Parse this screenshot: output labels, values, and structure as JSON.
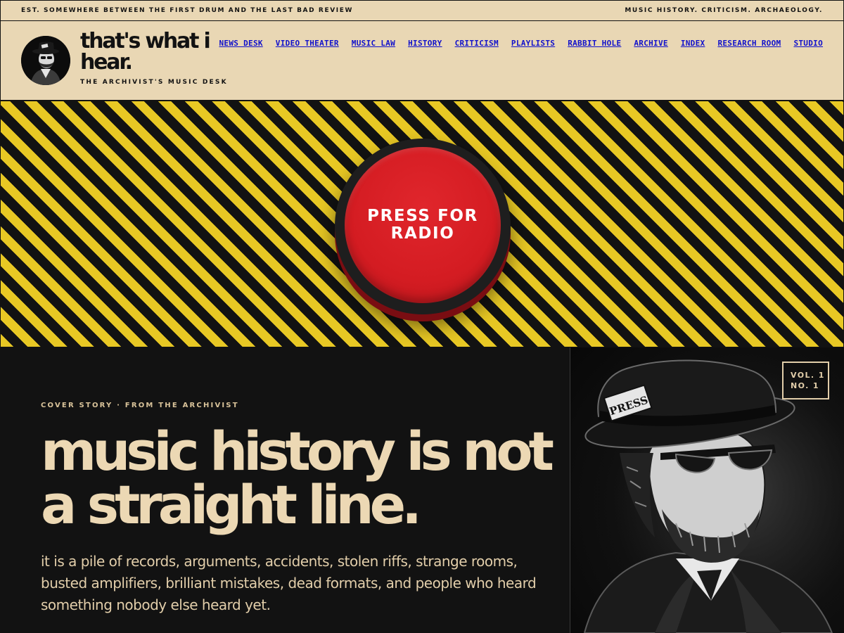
{
  "top_strip": {
    "left_text": "EST. SOMEWHERE BETWEEN THE FIRST DRUM AND THE LAST BAD REVIEW",
    "right_text": "MUSIC HISTORY. CRITICISM. ARCHAEOLOGY."
  },
  "brand": {
    "title": "that's what i hear.",
    "subtitle": "THE ARCHIVIST'S MUSIC DESK",
    "avatar_icon": "archivist-portrait-icon"
  },
  "nav": {
    "items": [
      {
        "label": "NEWS DESK"
      },
      {
        "label": "VIDEO THEATER"
      },
      {
        "label": "MUSIC LAW"
      },
      {
        "label": "HISTORY"
      },
      {
        "label": "CRITICISM"
      },
      {
        "label": "PLAYLISTS"
      },
      {
        "label": "RABBIT HOLE"
      },
      {
        "label": "ARCHIVE"
      },
      {
        "label": "INDEX"
      },
      {
        "label": "RESEARCH ROOM"
      },
      {
        "label": "STUDIO"
      }
    ]
  },
  "radio": {
    "label": "PRESS FOR RADIO"
  },
  "cover": {
    "kicker": "COVER STORY · FROM THE ARCHIVIST",
    "headline": "music history is not a straight line.",
    "dek": "it is a pile of records, arguments, accidents, stolen riffs, strange rooms, busted amplifiers, brilliant mistakes, dead formats, and people who heard something nobody else heard yet."
  },
  "issue_badge": {
    "line1": "VOL. 1",
    "line2": "NO. 1"
  },
  "portrait": {
    "hat_tag": "PRESS"
  },
  "colors": {
    "cream": "#e9d7b4",
    "ink": "#121212",
    "hazard_yellow": "#e8c824",
    "button_red": "#d41c22",
    "link_blue": "#1010cc"
  }
}
